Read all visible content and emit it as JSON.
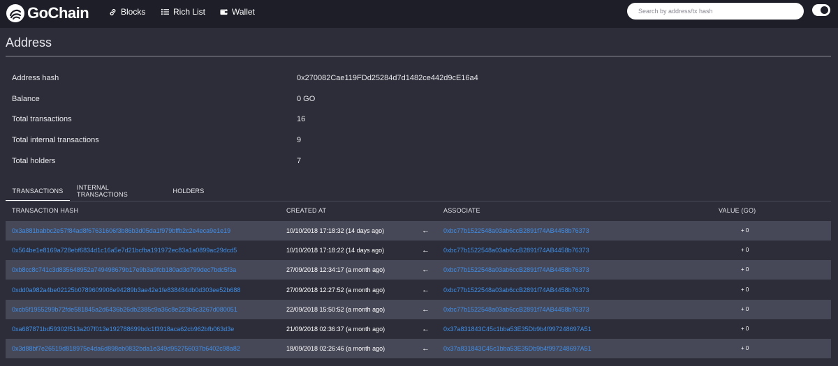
{
  "header": {
    "brand": "GoChain",
    "nav": [
      {
        "label": "Blocks",
        "icon": "link-icon"
      },
      {
        "label": "Rich List",
        "icon": "list-icon"
      },
      {
        "label": "Wallet",
        "icon": "wallet-icon"
      }
    ],
    "search_placeholder": "Search by address/tx hash"
  },
  "page": {
    "title": "Address"
  },
  "summary": [
    {
      "label": "Address hash",
      "value": "0x270082Cae119FDd25284d7d1482ce442d9cE16a4"
    },
    {
      "label": "Balance",
      "value": "0 GO"
    },
    {
      "label": "Total transactions",
      "value": "16"
    },
    {
      "label": "Total internal transactions",
      "value": "9"
    },
    {
      "label": "Total holders",
      "value": "7"
    }
  ],
  "tabs": [
    {
      "label": "TRANSACTIONS",
      "active": true
    },
    {
      "label": "INTERNAL TRANSACTIONS",
      "active": false
    },
    {
      "label": "HOLDERS",
      "active": false
    }
  ],
  "table": {
    "headers": [
      "TRANSACTION HASH",
      "CREATED AT",
      "ASSOCIATE",
      "VALUE (GO)"
    ],
    "rows": [
      {
        "hash": "0x3a881babbc2e57f84ad8f67631606f3b86b3d05da1f979bffb2c2e4eca9e1e19",
        "created": "10/10/2018 17:18:32 (14 days ago)",
        "direction": "←",
        "associate": "0xbc77b1522548a03ab6ccB2891f74AB4458b76373",
        "value": "+  0"
      },
      {
        "hash": "0x564be1e8169a728ebf6834d1c16a5e7d21bcfba191972ec83a1a0899ac29dcd5",
        "created": "10/10/2018 17:18:22 (14 days ago)",
        "direction": "←",
        "associate": "0xbc77b1522548a03ab6ccB2891f74AB4458b76373",
        "value": "+  0"
      },
      {
        "hash": "0xb8cc8c741c3d835648952a749498679b17e9b3a9fcb180ad3d799dec7bdc5f3a",
        "created": "27/09/2018 12:34:17 (a month ago)",
        "direction": "←",
        "associate": "0xbc77b1522548a03ab6ccB2891f74AB4458b76373",
        "value": "+  0"
      },
      {
        "hash": "0xdd0a982a4be02125b0789609908e94289b3ae42e1fe838484db0d303ee52b688",
        "created": "27/09/2018 12:27:52 (a month ago)",
        "direction": "←",
        "associate": "0xbc77b1522548a03ab6ccB2891f74AB4458b76373",
        "value": "+  0"
      },
      {
        "hash": "0xcb5f1955299b72fde581845a2d6436b26db2385c9a36c8e223b6c3267d080051",
        "created": "22/09/2018 15:50:52 (a month ago)",
        "direction": "←",
        "associate": "0xbc77b1522548a03ab6ccB2891f74AB4458b76373",
        "value": "+  0"
      },
      {
        "hash": "0xa687871bd59302f513a207f013e192788699bdc1f3918aca62cb962bfb063d3e",
        "created": "21/09/2018 02:36:37 (a month ago)",
        "direction": "←",
        "associate": "0x37a831843C45c1bba53E35Db9b4f997248697A51",
        "value": "+  0"
      },
      {
        "hash": "0x3d88bf7e26519d818975e4da6d898eb0832bda1e349d952756037b6402c98a82",
        "created": "18/09/2018 02:26:46 (a month ago)",
        "direction": "←",
        "associate": "0x37a831843C45c1bba53E35Db9b4f997248697A51",
        "value": "+  0"
      }
    ]
  },
  "colors": {
    "background": "#2c2d38",
    "navbar": "#1d1e27",
    "row_shaded": "#474857",
    "link": "#3f8ee8"
  }
}
